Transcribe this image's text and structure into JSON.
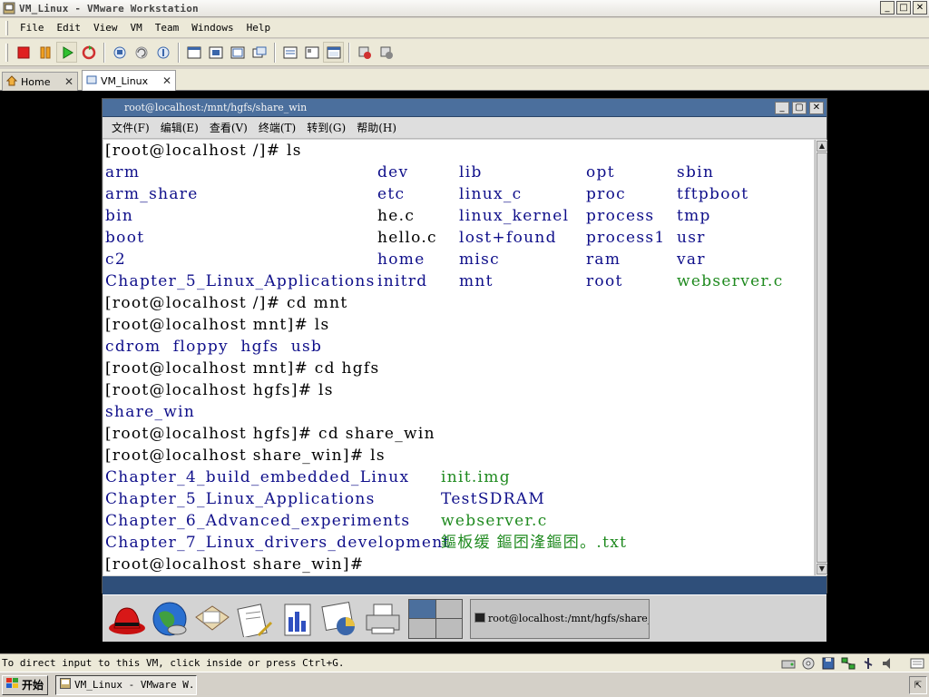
{
  "window": {
    "title": "VM_Linux - VMware Workstation",
    "min": "_",
    "max": "□",
    "close": "✕"
  },
  "menubar": [
    "File",
    "Edit",
    "View",
    "VM",
    "Team",
    "Windows",
    "Help"
  ],
  "toolbar": {
    "buttons": [
      "power-off",
      "pause",
      "power-on",
      "reset",
      "snapshot",
      "revert-snapshot",
      "snapshot-manager",
      "quick-switch",
      "full-screen",
      "summary",
      "console",
      "appliance-view",
      "show-hide-tabs",
      "connect",
      "disconnect"
    ]
  },
  "tabs": [
    {
      "label": "Home",
      "close": "✕"
    },
    {
      "label": "VM_Linux",
      "close": "✕"
    }
  ],
  "guest": {
    "terminal_title": "root@localhost:/mnt/hgfs/share_win",
    "menu": [
      "文件(F)",
      "编辑(E)",
      "查看(V)",
      "终端(T)",
      "转到(G)",
      "帮助(H)"
    ],
    "lines": [
      {
        "cells": [
          {
            "text": "[root@localhost /]# ls",
            "col": 0,
            "kind": "text"
          }
        ]
      },
      {
        "cells": [
          {
            "text": "arm",
            "col": 0,
            "kind": "dir"
          },
          {
            "text": "dev",
            "col": 1,
            "kind": "dir"
          },
          {
            "text": "lib",
            "col": 2,
            "kind": "dir"
          },
          {
            "text": "opt",
            "col": 3,
            "kind": "dir"
          },
          {
            "text": "sbin",
            "col": 4,
            "kind": "dir"
          }
        ]
      },
      {
        "cells": [
          {
            "text": "arm_share",
            "col": 0,
            "kind": "dir"
          },
          {
            "text": "etc",
            "col": 1,
            "kind": "dir"
          },
          {
            "text": "linux_c",
            "col": 2,
            "kind": "dir"
          },
          {
            "text": "proc",
            "col": 3,
            "kind": "dir"
          },
          {
            "text": "tftpboot",
            "col": 4,
            "kind": "dir"
          }
        ]
      },
      {
        "cells": [
          {
            "text": "bin",
            "col": 0,
            "kind": "dir"
          },
          {
            "text": "he.c",
            "col": 1,
            "kind": "text"
          },
          {
            "text": "linux_kernel",
            "col": 2,
            "kind": "dir"
          },
          {
            "text": "process",
            "col": 3,
            "kind": "dir"
          },
          {
            "text": "tmp",
            "col": 4,
            "kind": "dir"
          }
        ]
      },
      {
        "cells": [
          {
            "text": "boot",
            "col": 0,
            "kind": "dir"
          },
          {
            "text": "hello.c",
            "col": 1,
            "kind": "text"
          },
          {
            "text": "lost+found",
            "col": 2,
            "kind": "dir"
          },
          {
            "text": "process1",
            "col": 3,
            "kind": "dir"
          },
          {
            "text": "usr",
            "col": 4,
            "kind": "dir"
          }
        ]
      },
      {
        "cells": [
          {
            "text": "c2",
            "col": 0,
            "kind": "dir"
          },
          {
            "text": "home",
            "col": 1,
            "kind": "dir"
          },
          {
            "text": "misc",
            "col": 2,
            "kind": "dir"
          },
          {
            "text": "ram",
            "col": 3,
            "kind": "dir"
          },
          {
            "text": "var",
            "col": 4,
            "kind": "dir"
          }
        ]
      },
      {
        "cells": [
          {
            "text": "Chapter_5_Linux_Applications",
            "col": 0,
            "kind": "dir"
          },
          {
            "text": "initrd",
            "col": 1,
            "kind": "dir"
          },
          {
            "text": "mnt",
            "col": 2,
            "kind": "dir"
          },
          {
            "text": "root",
            "col": 3,
            "kind": "dir"
          },
          {
            "text": "webserver.c",
            "col": 4,
            "kind": "exe"
          }
        ]
      },
      {
        "cells": [
          {
            "text": "[root@localhost /]# cd mnt",
            "col": 0,
            "kind": "text"
          }
        ]
      },
      {
        "cells": [
          {
            "text": "[root@localhost mnt]# ls",
            "col": 0,
            "kind": "text"
          }
        ]
      },
      {
        "cells": [
          {
            "text": "cdrom  floppy  hgfs  usb",
            "col": 0,
            "kind": "dir"
          }
        ]
      },
      {
        "cells": [
          {
            "text": "[root@localhost mnt]# cd hgfs",
            "col": 0,
            "kind": "text"
          }
        ]
      },
      {
        "cells": [
          {
            "text": "[root@localhost hgfs]# ls",
            "col": 0,
            "kind": "text"
          }
        ]
      },
      {
        "cells": [
          {
            "text": "share_win",
            "col": 0,
            "kind": "dir"
          }
        ]
      },
      {
        "cells": [
          {
            "text": "[root@localhost hgfs]# cd share_win",
            "col": 0,
            "kind": "text"
          }
        ]
      },
      {
        "cells": [
          {
            "text": "[root@localhost share_win]# ls",
            "col": 0,
            "kind": "text"
          }
        ]
      },
      {
        "cells": [
          {
            "text": "Chapter_4_build_embedded_Linux",
            "col": 0,
            "kind": "dir"
          },
          {
            "text": "init.img",
            "col": 5,
            "kind": "exe"
          }
        ]
      },
      {
        "cells": [
          {
            "text": "Chapter_5_Linux_Applications",
            "col": 0,
            "kind": "dir"
          },
          {
            "text": "TestSDRAM",
            "col": 5,
            "kind": "dir"
          }
        ]
      },
      {
        "cells": [
          {
            "text": "Chapter_6_Advanced_experiments",
            "col": 0,
            "kind": "dir"
          },
          {
            "text": "webserver.c",
            "col": 5,
            "kind": "exe"
          }
        ]
      },
      {
        "cells": [
          {
            "text": "Chapter_7_Linux_drivers_development",
            "col": 0,
            "kind": "dir"
          },
          {
            "text": "鏂板缓 鏂囨湰鏂囨。.txt",
            "col": 5,
            "kind": "exe"
          }
        ]
      },
      {
        "cells": [
          {
            "text": "[root@localhost share_win]#",
            "col": 0,
            "kind": "text"
          }
        ]
      }
    ],
    "panel": {
      "launchers": [
        "redhat-menu-icon",
        "web-browser-icon",
        "mail-icon",
        "writer-icon",
        "spreadsheet-icon",
        "presentation-icon",
        "printer-icon"
      ],
      "task_label": "root@localhost:/mnt/hgfs/share_wi"
    }
  },
  "status": {
    "message": "To direct input to this VM, click inside or press Ctrl+G."
  },
  "taskbar": {
    "start_label": "开始",
    "task_label": "VM_Linux - VMware W..."
  },
  "colors": {
    "dir": "#0f0f8a",
    "exe": "#1f8a1f",
    "guest_title": "#4b6f9d"
  }
}
